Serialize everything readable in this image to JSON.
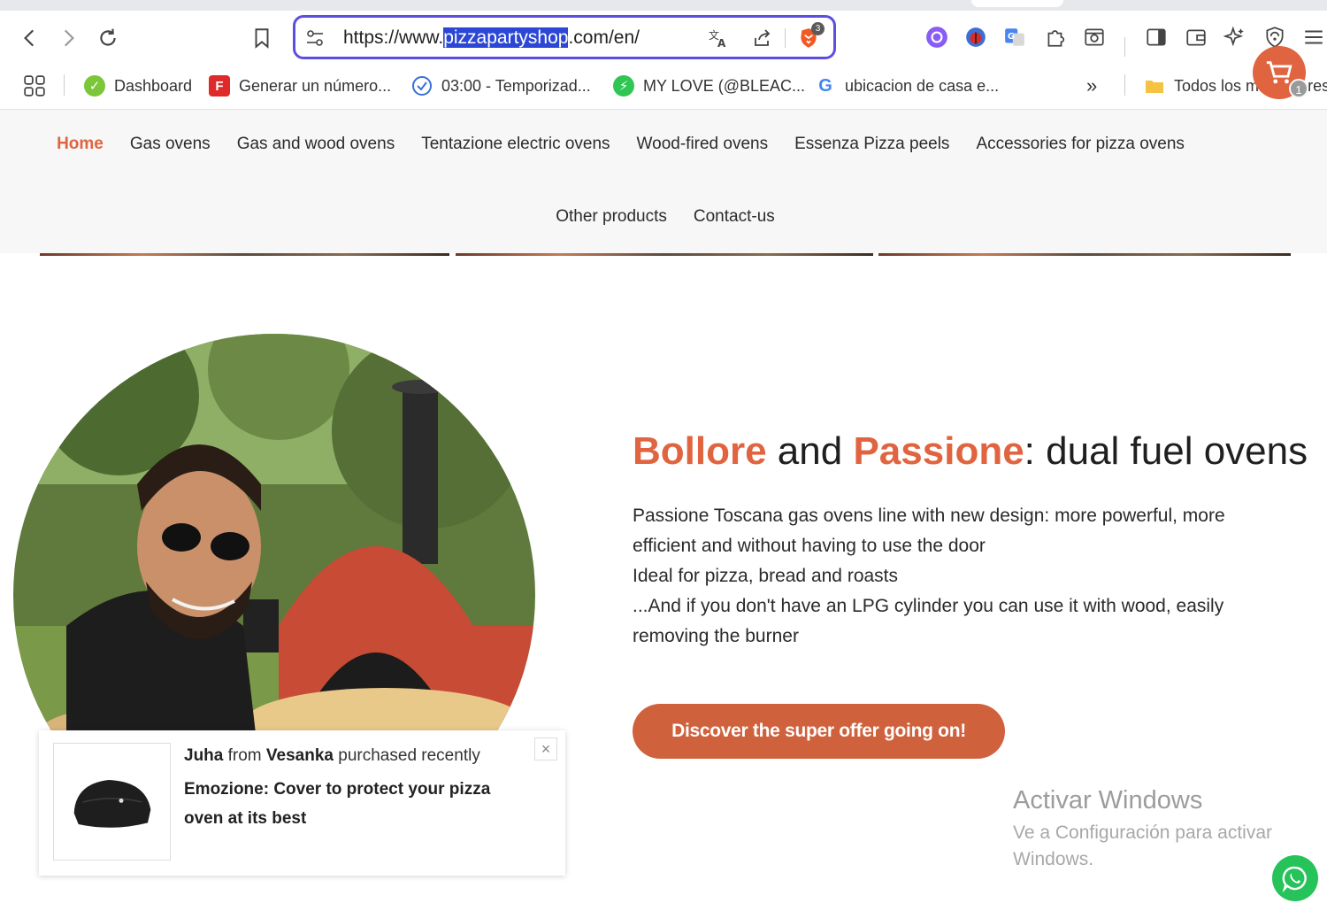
{
  "browser": {
    "url_prefix": "https://www.",
    "url_highlight": "pizzapartyshop",
    "url_suffix": ".com/en/",
    "shield_count": "3",
    "bookmarks": [
      {
        "label": "Dashboard",
        "icon": "dashboard-favicon"
      },
      {
        "label": "Generar un número...",
        "icon": "f-favicon"
      },
      {
        "label": "03:00 - Temporizad...",
        "icon": "timer-check-favicon"
      },
      {
        "label": "MY LOVE (@BLEAC...",
        "icon": "lightning-favicon"
      },
      {
        "label": "ubicacion de casa e...",
        "icon": "google-favicon"
      }
    ],
    "overflow_label": "»",
    "all_bookmarks_label": "Todos los marcadores"
  },
  "site": {
    "nav_row1": [
      "Home",
      "Gas ovens",
      "Gas and wood ovens",
      "Tentazione electric ovens",
      "Wood-fired ovens",
      "Essenza Pizza peels",
      "Accessories for pizza ovens"
    ],
    "nav_row2": [
      "Other products",
      "Contact-us"
    ],
    "cart_count": "1",
    "accent_color": "#e0643f"
  },
  "hero": {
    "title_word1": "Bollore",
    "title_and": " and ",
    "title_word2": "Passione",
    "title_rest": ": dual fuel ovens",
    "body_lines": [
      "Passione Toscana gas ovens line with new design: more powerful, more efficient and without having to use the door",
      "Ideal for pizza, bread and roasts",
      "...And if you don't have an LPG cylinder you can use it with wood, easily removing the burner"
    ],
    "cta_label": "Discover the super offer going on!"
  },
  "popup": {
    "buyer": "Juha",
    "from_word": " from ",
    "city": "Vesanka",
    "action": " purchased recently",
    "product": "Emozione: Cover to protect your pizza oven at its best",
    "close_symbol": "×"
  },
  "watermark": {
    "title": "Activar Windows",
    "subtitle": "Ve a Configuración para activar Windows."
  }
}
